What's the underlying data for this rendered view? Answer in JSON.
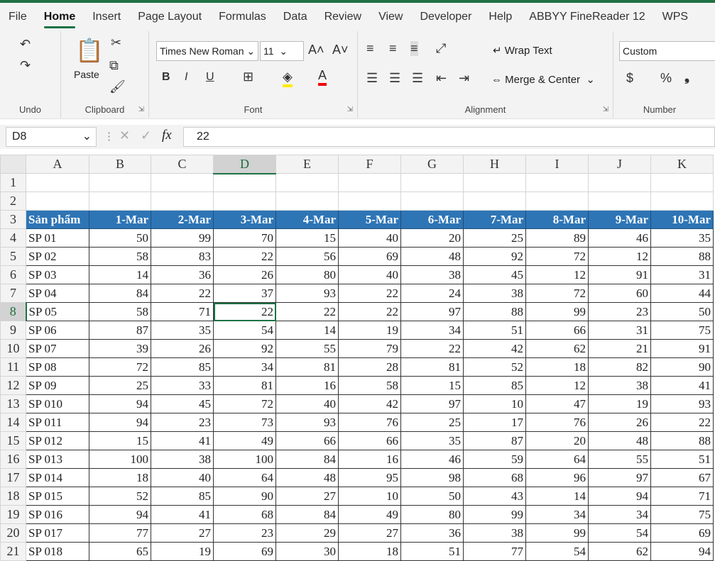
{
  "tabs": [
    "File",
    "Home",
    "Insert",
    "Page Layout",
    "Formulas",
    "Data",
    "Review",
    "View",
    "Developer",
    "Help",
    "ABBYY FineReader 12",
    "WPS"
  ],
  "active_tab": "Home",
  "ribbon": {
    "undo_label": "Undo",
    "clipboard_label": "Clipboard",
    "paste_label": "Paste",
    "font_label": "Font",
    "font_name": "Times New Roman",
    "font_size": "11",
    "bold": "B",
    "italic": "I",
    "underline": "U",
    "alignment_label": "Alignment",
    "wrap_text": "Wrap Text",
    "merge_center": "Merge & Center",
    "number_label": "Number",
    "number_format": "Custom",
    "currency": "$",
    "percent": "%"
  },
  "formula_bar": {
    "name_box": "D8",
    "fx": "fx",
    "value": "22"
  },
  "columns": [
    "A",
    "B",
    "C",
    "D",
    "E",
    "F",
    "G",
    "H",
    "I",
    "J",
    "K"
  ],
  "selected_cell": {
    "row": 8,
    "col": "D"
  },
  "header_row": [
    "Sản phẩm",
    "1-Mar",
    "2-Mar",
    "3-Mar",
    "4-Mar",
    "5-Mar",
    "6-Mar",
    "7-Mar",
    "8-Mar",
    "9-Mar",
    "10-Mar"
  ],
  "rows": [
    [
      "SP 01",
      50,
      99,
      70,
      15,
      40,
      20,
      25,
      89,
      46,
      35
    ],
    [
      "SP 02",
      58,
      83,
      22,
      56,
      69,
      48,
      92,
      72,
      12,
      88
    ],
    [
      "SP 03",
      14,
      36,
      26,
      80,
      40,
      38,
      45,
      12,
      91,
      31
    ],
    [
      "SP 04",
      84,
      22,
      37,
      93,
      22,
      24,
      38,
      72,
      60,
      44
    ],
    [
      "SP 05",
      58,
      71,
      22,
      22,
      22,
      97,
      88,
      99,
      23,
      50
    ],
    [
      "SP 06",
      87,
      35,
      54,
      14,
      19,
      34,
      51,
      66,
      31,
      75
    ],
    [
      "SP 07",
      39,
      26,
      92,
      55,
      79,
      22,
      42,
      62,
      21,
      91
    ],
    [
      "SP 08",
      72,
      85,
      34,
      81,
      28,
      81,
      52,
      18,
      82,
      90
    ],
    [
      "SP 09",
      25,
      33,
      81,
      16,
      58,
      15,
      85,
      12,
      38,
      41
    ],
    [
      "SP 010",
      94,
      45,
      72,
      40,
      42,
      97,
      10,
      47,
      19,
      93
    ],
    [
      "SP 011",
      94,
      23,
      73,
      93,
      76,
      25,
      17,
      76,
      26,
      22
    ],
    [
      "SP 012",
      15,
      41,
      49,
      66,
      66,
      35,
      87,
      20,
      48,
      88
    ],
    [
      "SP 013",
      100,
      38,
      100,
      84,
      16,
      46,
      59,
      64,
      55,
      51
    ],
    [
      "SP 014",
      18,
      40,
      64,
      48,
      95,
      98,
      68,
      96,
      97,
      67
    ],
    [
      "SP 015",
      52,
      85,
      90,
      27,
      10,
      50,
      43,
      14,
      94,
      71
    ],
    [
      "SP 016",
      94,
      41,
      68,
      84,
      49,
      80,
      99,
      34,
      34,
      75
    ],
    [
      "SP 017",
      77,
      27,
      23,
      29,
      27,
      36,
      38,
      99,
      54,
      69
    ],
    [
      "SP 018",
      65,
      19,
      69,
      30,
      18,
      51,
      77,
      54,
      62,
      94
    ]
  ],
  "header_color": "#2e75b6",
  "accent": "#1e7145"
}
